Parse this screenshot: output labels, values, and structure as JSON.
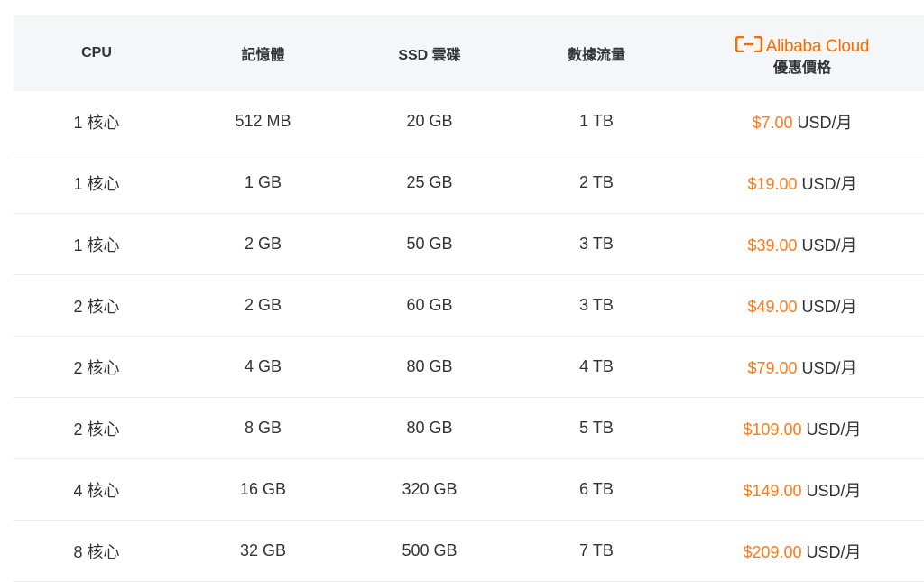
{
  "header": {
    "cpu": "CPU",
    "memory": "記憶體",
    "ssd": "SSD 雲碟",
    "traffic": "數據流量",
    "brand_name": "Alibaba Cloud",
    "price": "優惠價格"
  },
  "rows": [
    {
      "cpu": "1 核心",
      "memory": "512 MB",
      "ssd": "20 GB",
      "traffic": "1 TB",
      "price": "$7.00",
      "unit": "USD/月"
    },
    {
      "cpu": "1 核心",
      "memory": "1 GB",
      "ssd": "25 GB",
      "traffic": "2 TB",
      "price": "$19.00",
      "unit": "USD/月"
    },
    {
      "cpu": "1 核心",
      "memory": "2 GB",
      "ssd": "50 GB",
      "traffic": "3 TB",
      "price": "$39.00",
      "unit": "USD/月"
    },
    {
      "cpu": "2 核心",
      "memory": "2 GB",
      "ssd": "60 GB",
      "traffic": "3 TB",
      "price": "$49.00",
      "unit": "USD/月"
    },
    {
      "cpu": "2 核心",
      "memory": "4 GB",
      "ssd": "80 GB",
      "traffic": "4 TB",
      "price": "$79.00",
      "unit": "USD/月"
    },
    {
      "cpu": "2 核心",
      "memory": "8 GB",
      "ssd": "80 GB",
      "traffic": "5 TB",
      "price": "$109.00",
      "unit": "USD/月"
    },
    {
      "cpu": "4 核心",
      "memory": "16 GB",
      "ssd": "320 GB",
      "traffic": "6 TB",
      "price": "$149.00",
      "unit": "USD/月"
    },
    {
      "cpu": "8 核心",
      "memory": "32 GB",
      "ssd": "500 GB",
      "traffic": "7 TB",
      "price": "$209.00",
      "unit": "USD/月"
    }
  ],
  "colors": {
    "accent": "#ff6a00",
    "header_bg": "#f4f6f8"
  },
  "icons": {
    "brand_logo": "alibaba-cloud-logo-icon"
  }
}
